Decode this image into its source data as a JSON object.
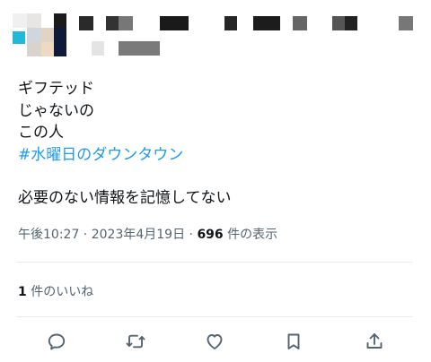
{
  "tweet": {
    "lines": [
      "ギフテッド",
      "じゃないの",
      "この人"
    ],
    "hashtag": "#水曜日のダウンタウン",
    "line_after_gap": "必要のない情報を記憶してない"
  },
  "meta": {
    "time": "午後10:27",
    "sep1": " · ",
    "date": "2023年4月19日",
    "sep2": " · ",
    "views": "696",
    "views_label": " 件の表示"
  },
  "likes": {
    "count": "1",
    "label": " 件のいいね"
  },
  "actions": {
    "reply_icon": "reply-icon",
    "retweet_icon": "retweet-icon",
    "like_icon": "like-icon",
    "bookmark_icon": "bookmark-icon",
    "share_icon": "share-icon"
  },
  "colors": {
    "hashtag": "#1d9bf0",
    "secondary": "#536471",
    "divider": "#e6ecf0"
  }
}
